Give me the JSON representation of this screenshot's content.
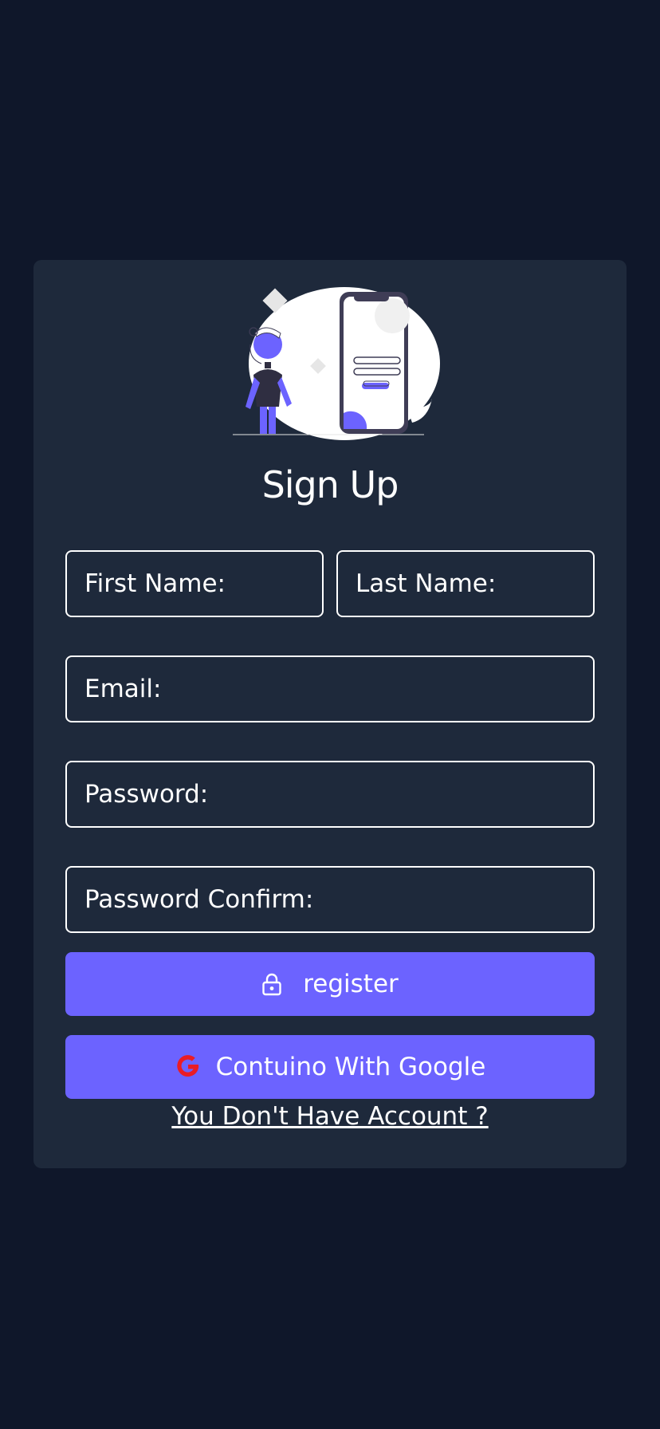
{
  "form": {
    "title": "Sign Up",
    "first_name_placeholder": "First Name:",
    "last_name_placeholder": "Last Name:",
    "email_placeholder": "Email:",
    "password_placeholder": "Password:",
    "password_confirm_placeholder": "Password Confirm:",
    "register_label": "register",
    "google_label": "Contuino With Google",
    "account_link": "You Don't Have Account ?"
  },
  "icons": {
    "register": "lock-icon",
    "google": "google-icon",
    "illustration": "sign-up-illustration"
  },
  "colors": {
    "background": "#0f172a",
    "card": "#1e293b",
    "accent": "#6c63ff",
    "google_red": "#ea1c25"
  }
}
